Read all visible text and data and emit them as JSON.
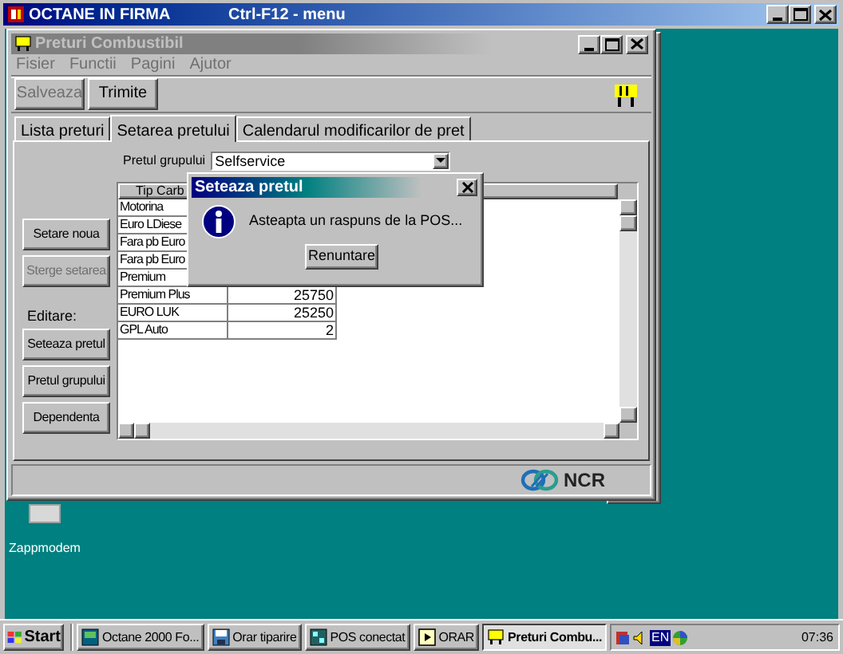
{
  "outer_window": {
    "title": "OCTANE IN FIRMA",
    "hint": "Ctrl-F12 - menu"
  },
  "window": {
    "title": "Preturi Combustibil",
    "active": false
  },
  "menu": [
    {
      "label": "Fisier",
      "disabled": true
    },
    {
      "label": "Functii",
      "disabled": true
    },
    {
      "label": "Pagini",
      "disabled": true
    },
    {
      "label": "Ajutor",
      "disabled": true
    }
  ],
  "toolbar": [
    {
      "label": "Salveaza",
      "disabled": true
    },
    {
      "label": "Trimite",
      "disabled": false
    }
  ],
  "tabs": [
    {
      "label": "Lista preturi",
      "selected": false
    },
    {
      "label": "Setarea pretului",
      "selected": true
    },
    {
      "label": "Calendarul modificarilor de pret",
      "selected": false
    }
  ],
  "group_price": {
    "label": "Pretul grupului",
    "value": "Selfservice"
  },
  "side_panel": [
    {
      "kind": "button",
      "label": "Setare noua",
      "disabled": false
    },
    {
      "kind": "button",
      "label": "Sterge setarea",
      "disabled": true
    },
    {
      "kind": "label",
      "label": "Editare:"
    },
    {
      "kind": "button",
      "label": "Seteaza pretul",
      "disabled": false
    },
    {
      "kind": "button",
      "label": "Pretul grupului",
      "disabled": false
    },
    {
      "kind": "button",
      "label": "Dependenta",
      "disabled": false
    }
  ],
  "table": {
    "columns": [
      "Tip Carb"
    ],
    "rows": [
      {
        "fuel": "Motorina"
      },
      {
        "fuel": "Euro LDiese"
      },
      {
        "fuel": "Fara pb Euro"
      },
      {
        "fuel": "Fara pb Euro"
      },
      {
        "fuel": "Premium"
      },
      {
        "fuel": "Premium Plus",
        "price": "25750"
      },
      {
        "fuel": "EURO LUK",
        "price": "25250"
      },
      {
        "fuel": "GPL Auto",
        "price": "2"
      }
    ]
  },
  "dialog": {
    "title": "Seteaza pretul",
    "message": "Asteapta un raspuns de la POS...",
    "button": "Renuntare"
  },
  "status_bar": {
    "logo": "NCR"
  },
  "desktop_icons": [
    {
      "label": "Zappmodem"
    }
  ],
  "taskbar": {
    "start": "Start",
    "tasks": [
      {
        "label": "Octane 2000 Fo...",
        "selected": false
      },
      {
        "label": "Orar tiparire",
        "selected": false
      },
      {
        "label": "POS conectat",
        "selected": false
      },
      {
        "label": "ORAR",
        "selected": false
      },
      {
        "label": "Preturi Combu...",
        "selected": true
      }
    ],
    "language": "EN",
    "clock": "07:36"
  }
}
